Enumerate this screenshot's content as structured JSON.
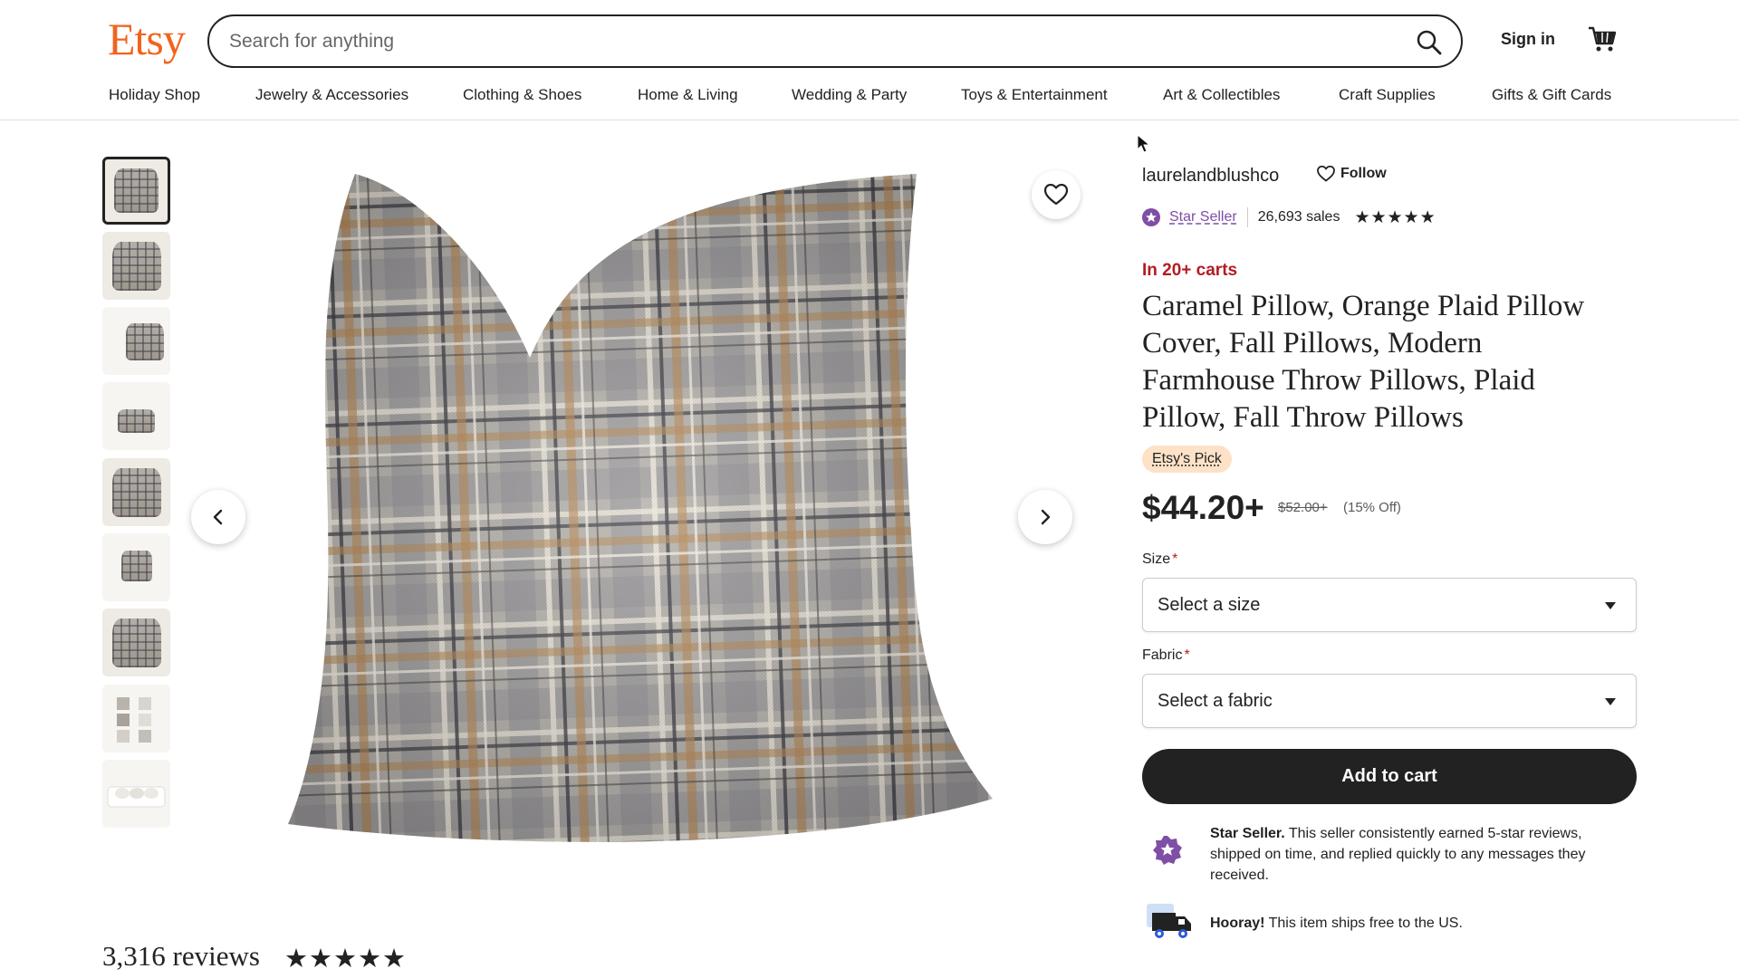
{
  "header": {
    "logo": "Etsy",
    "search_placeholder": "Search for anything",
    "signin": "Sign in"
  },
  "nav": [
    "Holiday Shop",
    "Jewelry & Accessories",
    "Clothing & Shoes",
    "Home & Living",
    "Wedding & Party",
    "Toys & Entertainment",
    "Art & Collectibles",
    "Craft Supplies",
    "Gifts & Gift Cards"
  ],
  "gallery": {
    "thumbnail_count": 9,
    "active_thumbnail": 1
  },
  "listing": {
    "shop_name": "laurelandblushco",
    "follow_label": "Follow",
    "star_seller_label": "Star Seller",
    "sales": "26,693 sales",
    "shop_rating_stars": "★★★★★",
    "in_carts": "In 20+ carts",
    "title": "Caramel Pillow, Orange Plaid Pillow Cover, Fall Pillows, Modern Farmhouse Throw Pillows, Plaid Pillow, Fall Throw Pillows",
    "etsy_pick": "Etsy's Pick",
    "price": "$44.20+",
    "original_price": "$52.00+",
    "discount": "(15% Off)",
    "size_label": "Size",
    "size_placeholder": "Select a size",
    "fabric_label": "Fabric",
    "fabric_placeholder": "Select a fabric",
    "required_marker": "*",
    "add_to_cart": "Add to cart",
    "star_seller_title": "Star Seller.",
    "star_seller_text": " This seller consistently earned 5-star reviews, shipped on time, and replied quickly to any messages they received.",
    "shipping_title": "Hooray!",
    "shipping_text": " This item ships free to the US."
  },
  "reviews": {
    "count_label": "3,316 reviews",
    "stars": "★★★★★"
  },
  "colors": {
    "brand": "#f1641e",
    "star_seller": "#7f4ea5",
    "urgent": "#b31c22",
    "pick_badge": "#fde2c7"
  }
}
